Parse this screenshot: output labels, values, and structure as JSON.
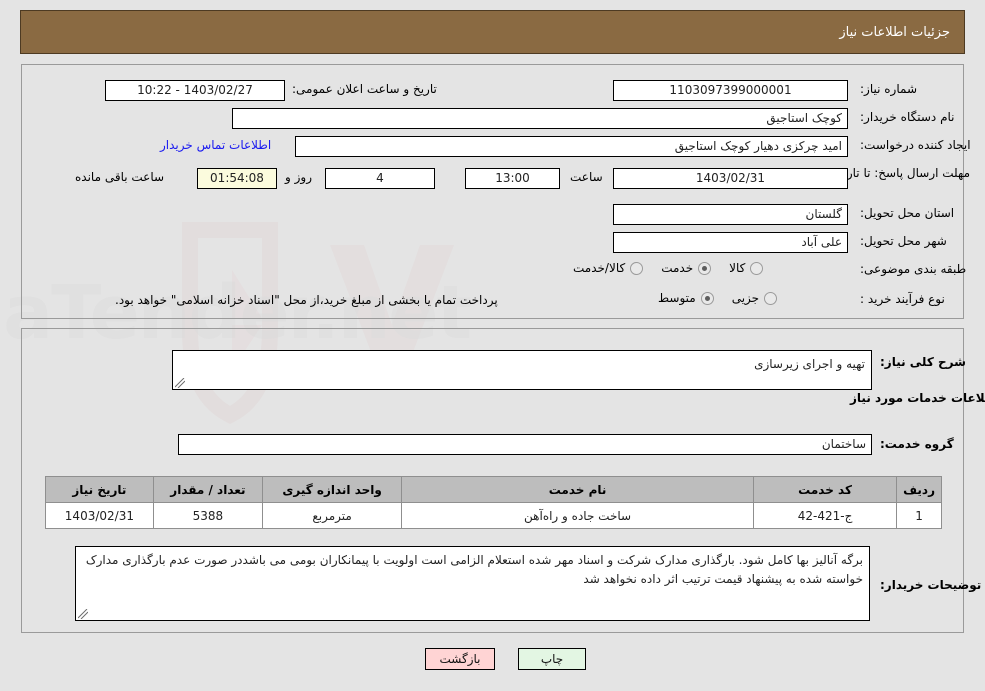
{
  "header": {
    "title": "جزئیات اطلاعات نیاز"
  },
  "colors": {
    "header_bg": "#8a6a42",
    "header_text": "#ffffff",
    "page_bg": "#e4e4e4",
    "link": "#1a1af0",
    "timer_bg": "#fbfbdd",
    "table_header_bg": "#bdbdbd",
    "print_btn_bg": "#e3f6e3",
    "back_btn_bg": "#ffd4d4"
  },
  "top_panel": {
    "need_number_label": "شماره نیاز:",
    "need_number_value": "1103097399000001",
    "public_announce_label": "تاریخ و ساعت اعلان عمومی:",
    "public_announce_value": "1403/02/27 - 10:22",
    "buyer_org_label": "نام دستگاه خریدار:",
    "buyer_org_value": "کوچک استاجیق",
    "requester_label": "ایجاد کننده درخواست:",
    "requester_value": "امید چرکزی دهیار کوچک استاجیق",
    "buyer_contact_link": "اطلاعات تماس خریدار",
    "deadline_label": "مهلت ارسال پاسخ: تا تاریخ:",
    "deadline_date": "1403/02/31",
    "hour_label": "ساعت",
    "deadline_time": "13:00",
    "remaining_days": "4",
    "days_and_label": "روز و",
    "remaining_timer": "01:54:08",
    "remaining_suffix": "ساعت باقی مانده",
    "province_label": "استان محل تحویل:",
    "province_value": "گلستان",
    "city_label": "شهر محل تحویل:",
    "city_value": "علی آباد",
    "category_label": "طبقه بندی موضوعی:",
    "category_options": [
      {
        "label": "کالا",
        "selected": false
      },
      {
        "label": "خدمت",
        "selected": true
      },
      {
        "label": "کالا/خدمت",
        "selected": false
      }
    ],
    "process_label": "نوع فرآیند خرید :",
    "process_options": [
      {
        "label": "جزیی",
        "selected": false
      },
      {
        "label": "متوسط",
        "selected": true
      }
    ],
    "payment_note": "پرداخت تمام یا بخشی از مبلغ خرید،از محل \"اسناد خزانه اسلامی\" خواهد بود."
  },
  "bottom_panel": {
    "overall_desc_label": "شرح کلی نیاز:",
    "overall_desc_value": "تهیه و اجرای زیرسازی",
    "services_section_title": "اطلاعات خدمات مورد نیاز",
    "service_group_label": "گروه خدمت:",
    "service_group_value": "ساختمان",
    "buyer_notes_label": "توضیحات خریدار:",
    "buyer_notes_value": "برگه آنالیز بها کامل شود. بارگذاری مدارک شرکت و اسناد مهر شده استعلام الزامی است اولویت با پیمانکاران بومی می باشددر صورت عدم بارگذاری مدارک خواسته شده به پیشنهاد قیمت ترتیب اثر داده نخواهد شد"
  },
  "table": {
    "columns": [
      "ردیف",
      "کد خدمت",
      "نام خدمت",
      "واحد اندازه گیری",
      "تعداد / مقدار",
      "تاریخ نیاز"
    ],
    "rows": [
      {
        "row_no": "1",
        "service_code": "ج-421-42",
        "service_name": "ساخت جاده و راه‌آهن",
        "unit": "مترمربع",
        "quantity": "5388",
        "need_date": "1403/02/31"
      }
    ]
  },
  "footer": {
    "print_label": "چاپ",
    "back_label": "بازگشت"
  },
  "watermark": {
    "text": "AriaTender.net"
  }
}
